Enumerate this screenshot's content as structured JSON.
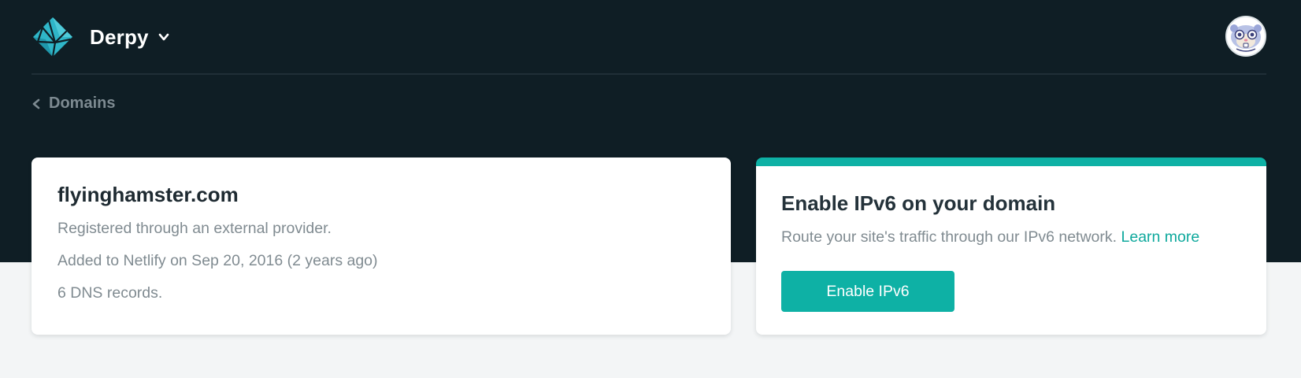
{
  "header": {
    "team_name": "Derpy",
    "logo_icon": "netlify-logo-icon",
    "team_menu_icon": "chevron-down-icon",
    "avatar_icon": "hamster-avatar-icon"
  },
  "breadcrumb": {
    "label": "Domains",
    "icon": "chevron-left-icon"
  },
  "domain_card": {
    "title": "flyinghamster.com",
    "lines": [
      "Registered through an external provider.",
      "Added to Netlify on Sep 20, 2016 (2 years ago)",
      "6 DNS records."
    ]
  },
  "ipv6_card": {
    "title": "Enable IPv6 on your domain",
    "description": "Route your site's traffic through our IPv6 network.",
    "learn_more": "Learn more",
    "button_label": "Enable IPv6"
  },
  "colors": {
    "header_bg": "#0f1e25",
    "page_bg": "#f3f5f6",
    "accent_teal": "#0eb1a5"
  }
}
